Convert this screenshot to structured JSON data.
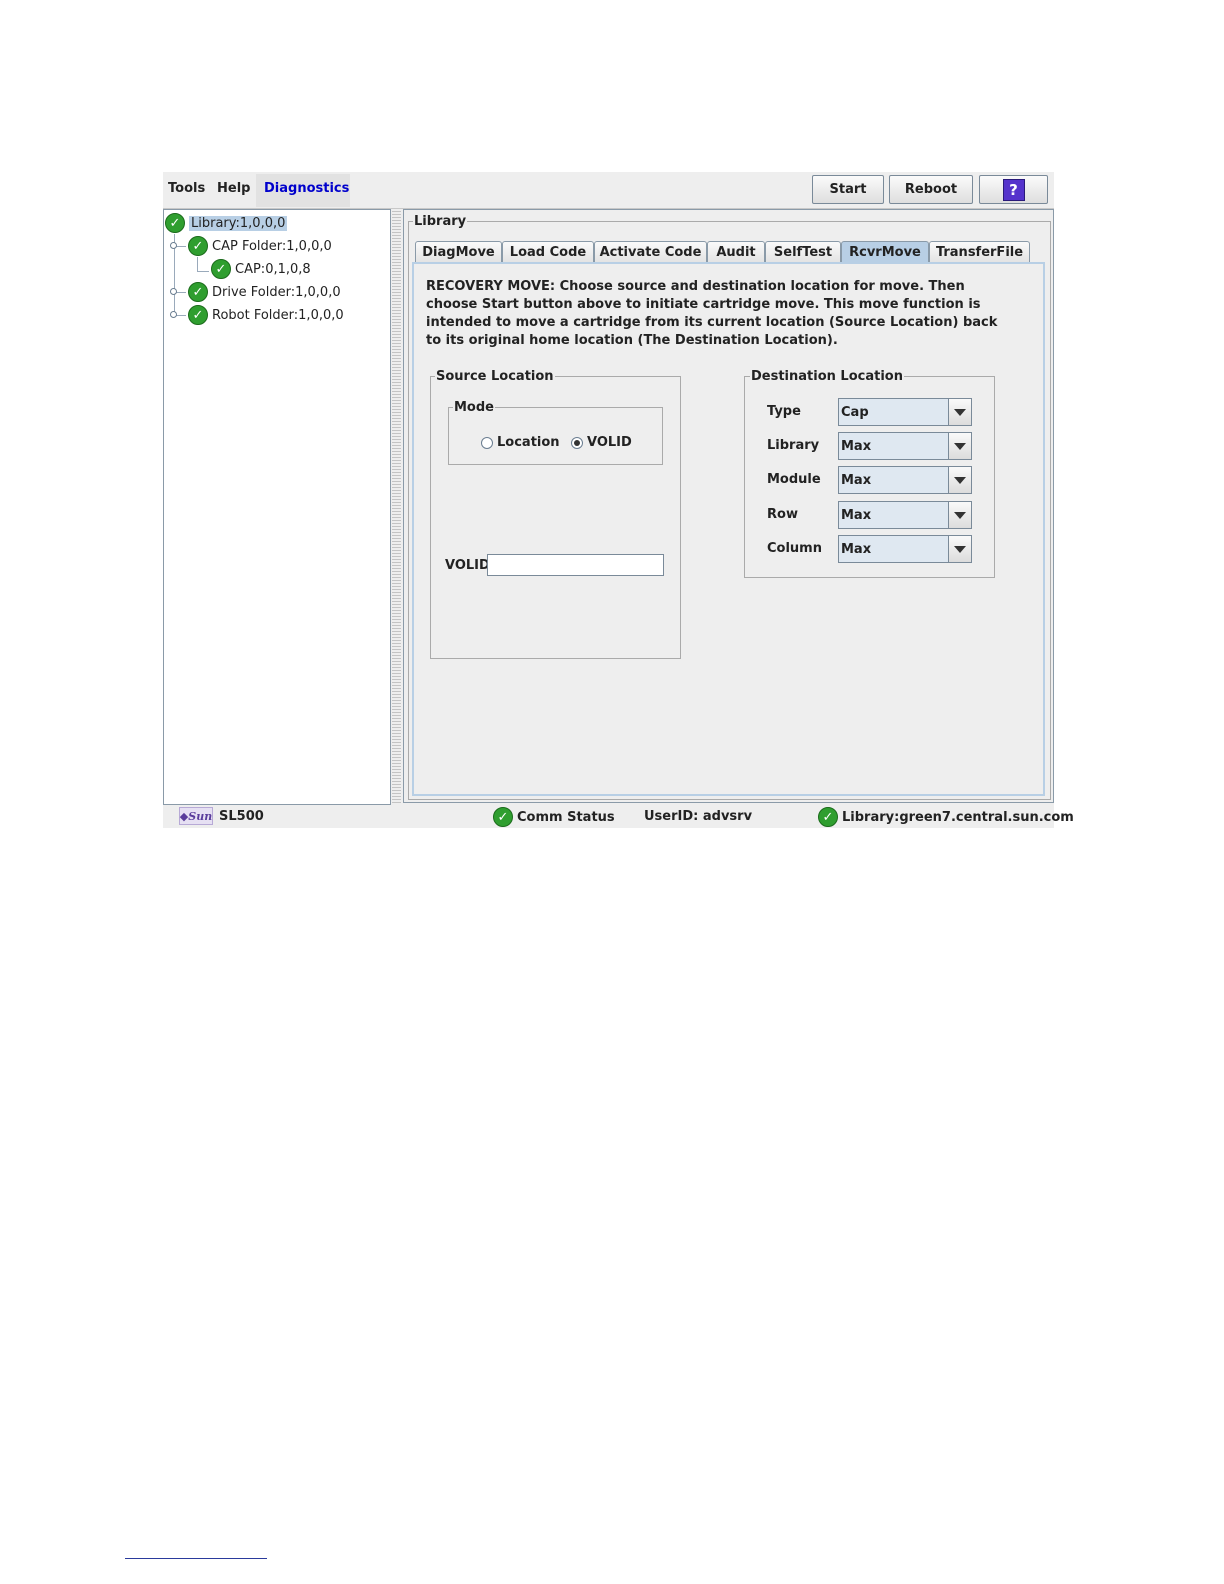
{
  "menubar": {
    "items": [
      "Tools",
      "Help",
      "Diagnostics"
    ],
    "active_item": "Diagnostics",
    "buttons": {
      "start": "Start",
      "reboot": "Reboot",
      "help": "?"
    }
  },
  "tree": {
    "nodes": [
      {
        "label": "Library:1,0,0,0",
        "selected": true,
        "status": "ok"
      },
      {
        "label": "CAP Folder:1,0,0,0",
        "status": "ok"
      },
      {
        "label": "CAP:0,1,0,8",
        "status": "ok"
      },
      {
        "label": "Drive Folder:1,0,0,0",
        "status": "ok"
      },
      {
        "label": "Robot Folder:1,0,0,0",
        "status": "ok"
      }
    ]
  },
  "main": {
    "group_title": "Library",
    "tabs": [
      "DiagMove",
      "Load Code",
      "Activate Code",
      "Audit",
      "SelfTest",
      "RcvrMove",
      "TransferFile"
    ],
    "active_tab": "RcvrMove",
    "description": "RECOVERY MOVE: Choose source and destination location for move. Then choose Start button above to initiate cartridge move. This move function is intended to move a cartridge from its current location (Source Location) back to its original home location (The Destination Location).",
    "source": {
      "title": "Source Location",
      "mode_title": "Mode",
      "mode_options": [
        "Location",
        "VOLID"
      ],
      "mode_selected": "VOLID",
      "volid_label": "VOLID",
      "volid_value": ""
    },
    "destination": {
      "title": "Destination Location",
      "fields": [
        {
          "label": "Type",
          "value": "Cap"
        },
        {
          "label": "Library",
          "value": "Max"
        },
        {
          "label": "Module",
          "value": "Max"
        },
        {
          "label": "Row",
          "value": "Max"
        },
        {
          "label": "Column",
          "value": "Max"
        }
      ]
    }
  },
  "statusbar": {
    "product": "SL500",
    "comm_status": "Comm Status",
    "user": "UserID: advsrv",
    "library": "Library:green7.central.sun.com"
  },
  "colors": {
    "accent": "#0000cc",
    "selection": "#b8cfe5",
    "ok": "#2f9e2f"
  },
  "icons": {
    "status_ok": "check-circle-icon",
    "logo": "sun-logo-icon"
  }
}
